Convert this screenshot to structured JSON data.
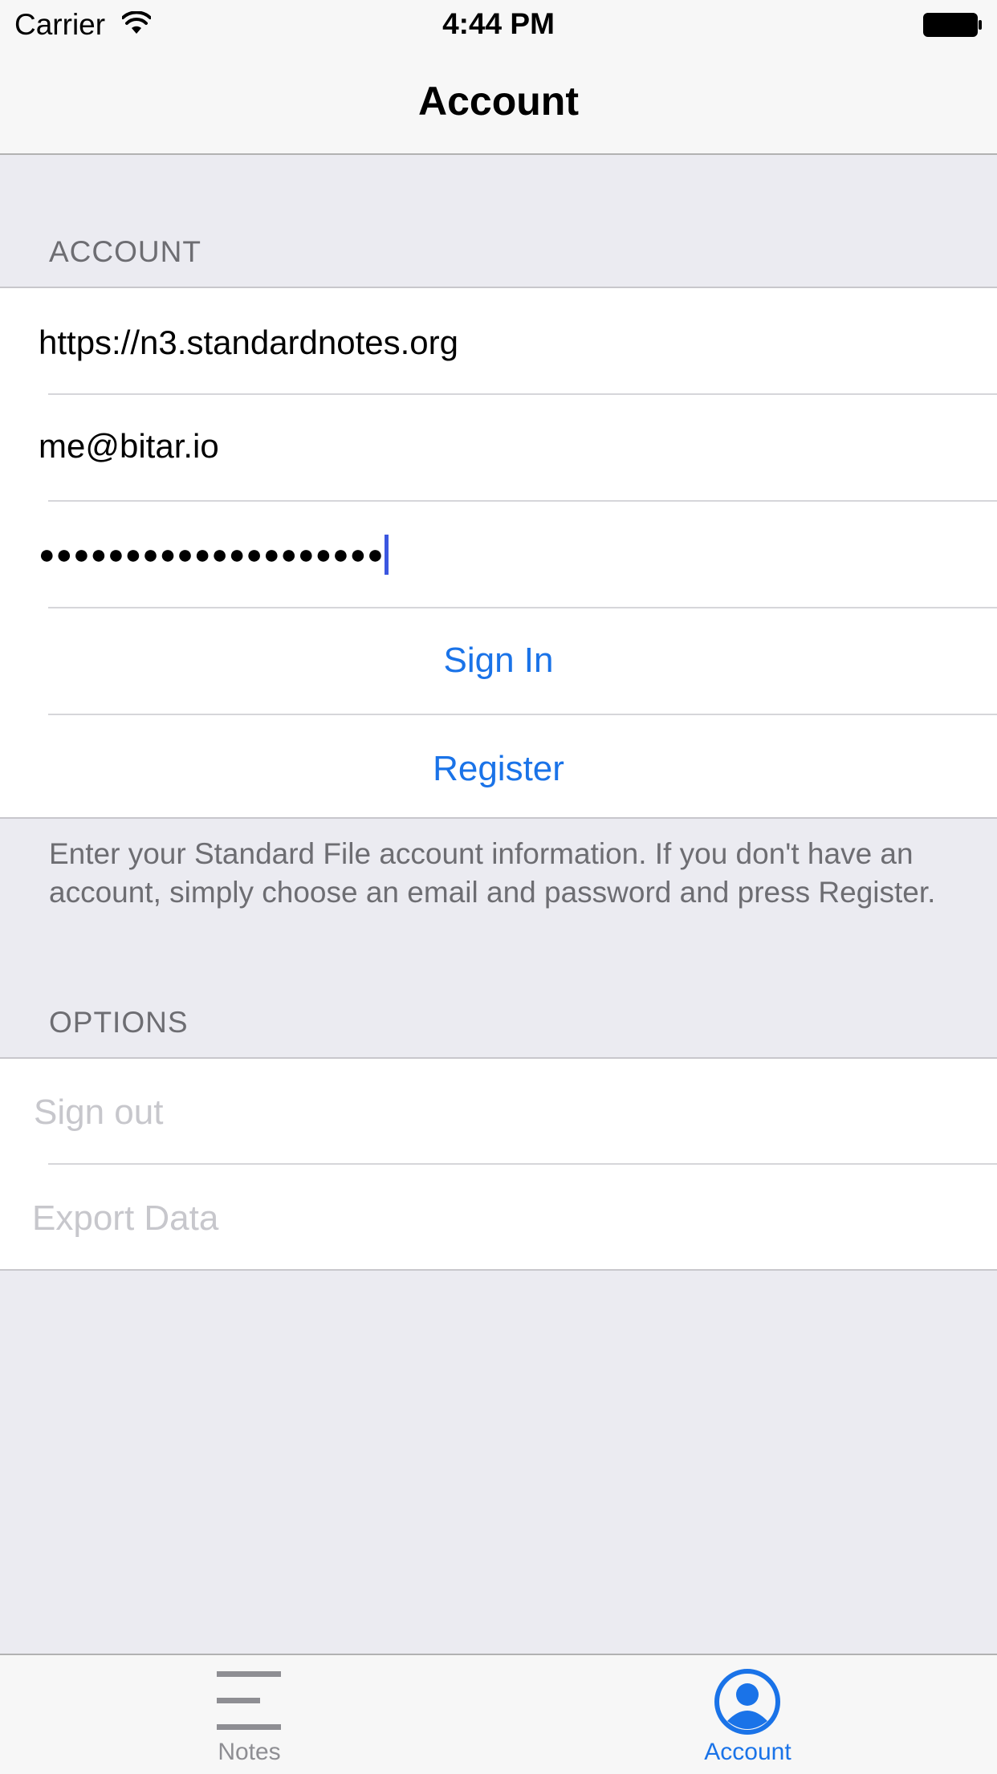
{
  "status_bar": {
    "carrier": "Carrier",
    "time": "4:44 PM",
    "icons": [
      "wifi-icon",
      "battery-icon"
    ]
  },
  "nav": {
    "title": "Account"
  },
  "account_section": {
    "header": "ACCOUNT",
    "server": "https://n3.standardnotes.org",
    "email": "me@bitar.io",
    "password_masked": "●●●●●●●●●●●●●●●●●●●●",
    "sign_in_label": "Sign In",
    "register_label": "Register",
    "footer": "Enter your Standard File account information. If you don't have an account, simply choose an email and password and press Register."
  },
  "options_section": {
    "header": "OPTIONS",
    "items": [
      {
        "label": "Sign out",
        "enabled": false
      },
      {
        "label": "Export Data",
        "enabled": false
      }
    ]
  },
  "tab_bar": {
    "tabs": [
      {
        "label": "Notes",
        "icon": "menu-lines-icon",
        "selected": false
      },
      {
        "label": "Account",
        "icon": "account-circle-icon",
        "selected": true
      }
    ]
  },
  "colors": {
    "accent": "#1a73e8",
    "background": "#ebebf1",
    "disabled_text": "#c7c7cc",
    "secondary_text": "#6d6d72",
    "cursor": "#3b57e0",
    "tab_inactive": "#8e8e93"
  }
}
